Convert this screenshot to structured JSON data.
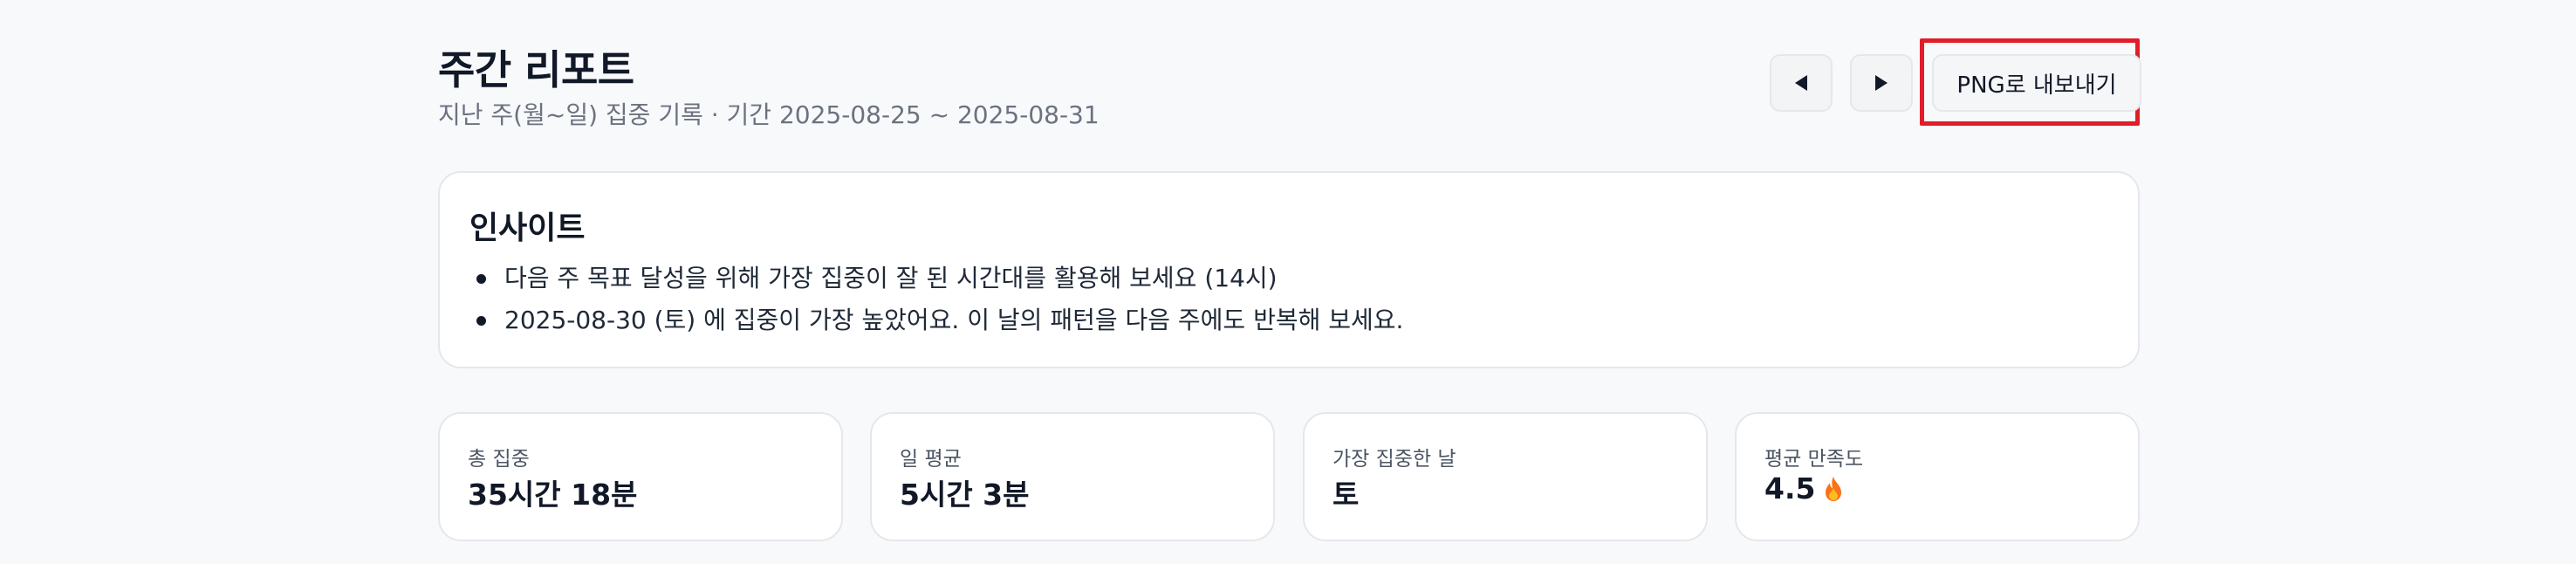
{
  "header": {
    "title": "주간 리포트",
    "subtitle": "지난 주(월~일) 집중 기록 · 기간 2025-08-25 ~ 2025-08-31",
    "prev_icon": "chevron-left-icon",
    "next_icon": "chevron-right-icon",
    "export_label": "PNG로 내보내기",
    "highlight_color": "#e11d2a"
  },
  "insights": {
    "title": "인사이트",
    "items": [
      "다음 주 목표 달성을 위해 가장 집중이 잘 된 시간대를 활용해 보세요 (14시)",
      "2025-08-30 (토) 에 집중이 가장 높았어요. 이 날의 패턴을 다음 주에도 반복해 보세요."
    ]
  },
  "stats": [
    {
      "label": "총 집중",
      "value": "35시간 18분"
    },
    {
      "label": "일 평균",
      "value": "5시간 3분"
    },
    {
      "label": "가장 집중한 날",
      "value": "토"
    },
    {
      "label": "평균 만족도",
      "value": "4.5",
      "icon": "fire-icon"
    }
  ]
}
